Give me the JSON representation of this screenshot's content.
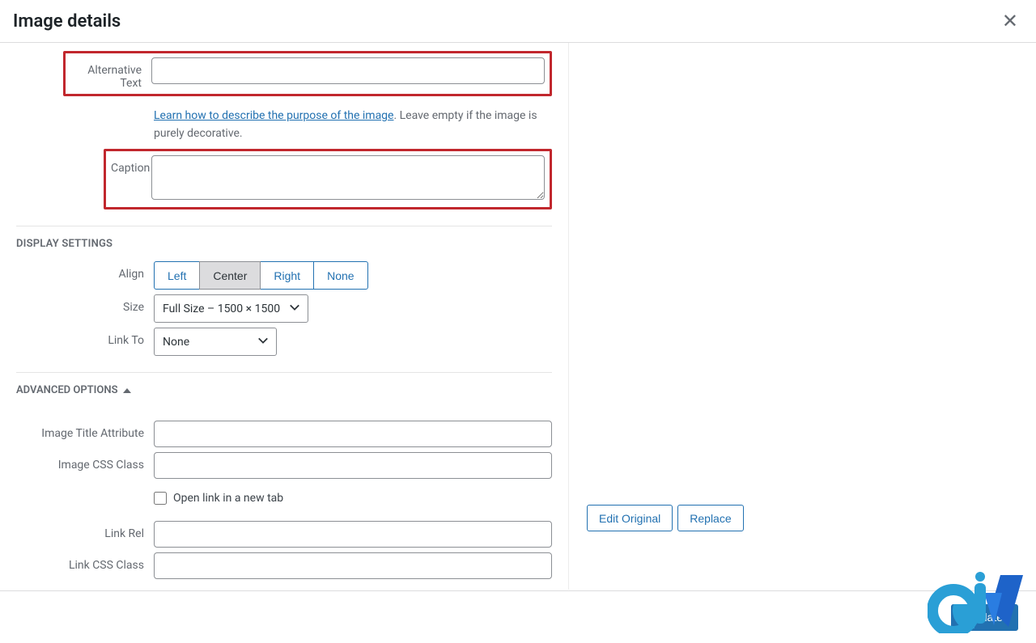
{
  "header": {
    "title": "Image details"
  },
  "fields": {
    "alt_label": "Alternative Text",
    "alt_value": "",
    "alt_help_link": "Learn how to describe the purpose of the image",
    "alt_help_rest": ". Leave empty if the image is purely decorative.",
    "caption_label": "Caption",
    "caption_value": ""
  },
  "display": {
    "section_label": "DISPLAY SETTINGS",
    "align_label": "Align",
    "align_options": {
      "left": "Left",
      "center": "Center",
      "right": "Right",
      "none": "None"
    },
    "size_label": "Size",
    "size_value": "Full Size – 1500 × 1500",
    "linkto_label": "Link To",
    "linkto_value": "None"
  },
  "advanced": {
    "section_label": "ADVANCED OPTIONS",
    "title_attr_label": "Image Title Attribute",
    "title_attr_value": "",
    "css_class_label": "Image CSS Class",
    "css_class_value": "",
    "open_new_tab_label": "Open link in a new tab",
    "link_rel_label": "Link Rel",
    "link_rel_value": "",
    "link_css_label": "Link CSS Class",
    "link_css_value": ""
  },
  "preview": {
    "edit_original": "Edit Original",
    "replace": "Replace"
  },
  "footer": {
    "update": "Update"
  }
}
